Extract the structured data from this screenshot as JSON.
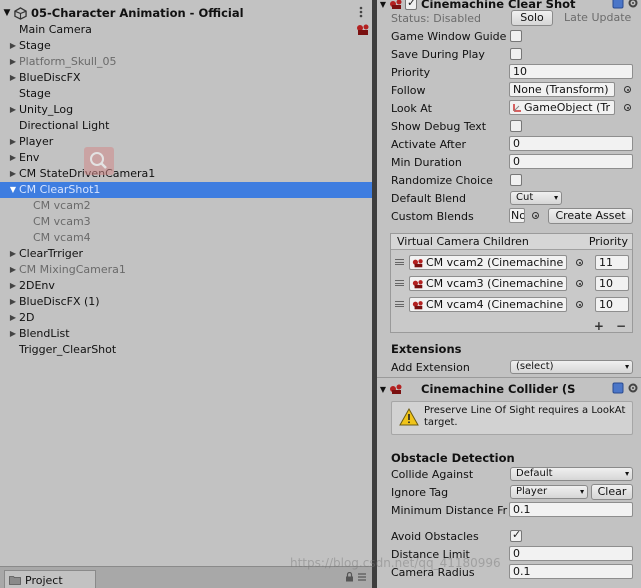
{
  "hierarchy": {
    "scene_title": "05-Character Animation - Official",
    "items": [
      {
        "label": "Main Camera",
        "indent": 0,
        "expand": false,
        "dim": false,
        "sel": false,
        "icon": "camera-gizmo"
      },
      {
        "label": "Stage",
        "indent": 0,
        "expand": true,
        "dim": false,
        "sel": false
      },
      {
        "label": "Platform_Skull_05",
        "indent": 0,
        "expand": true,
        "dim": true,
        "sel": false
      },
      {
        "label": "BlueDiscFX",
        "indent": 0,
        "expand": true,
        "dim": false,
        "sel": false
      },
      {
        "label": "Stage",
        "indent": 0,
        "expand": false,
        "dim": false,
        "sel": false
      },
      {
        "label": "Unity_Log",
        "indent": 0,
        "expand": true,
        "dim": false,
        "sel": false
      },
      {
        "label": "Directional Light",
        "indent": 0,
        "expand": false,
        "dim": false,
        "sel": false
      },
      {
        "label": "Player",
        "indent": 0,
        "expand": true,
        "dim": false,
        "sel": false
      },
      {
        "label": "Env",
        "indent": 0,
        "expand": true,
        "dim": false,
        "sel": false
      },
      {
        "label": "CM StateDrivenCamera1",
        "indent": 0,
        "expand": true,
        "dim": false,
        "sel": false
      },
      {
        "label": "CM ClearShot1",
        "indent": 0,
        "expand": true,
        "open": true,
        "dim": false,
        "sel": true
      },
      {
        "label": "CM vcam2",
        "indent": 1,
        "expand": false,
        "dim": true,
        "sel": false
      },
      {
        "label": "CM vcam3",
        "indent": 1,
        "expand": false,
        "dim": true,
        "sel": false
      },
      {
        "label": "CM vcam4",
        "indent": 1,
        "expand": false,
        "dim": true,
        "sel": false
      },
      {
        "label": "ClearTrriger",
        "indent": 0,
        "expand": true,
        "dim": false,
        "sel": false
      },
      {
        "label": "CM MixingCamera1",
        "indent": 0,
        "expand": true,
        "dim": true,
        "sel": false
      },
      {
        "label": "2DEnv",
        "indent": 0,
        "expand": true,
        "dim": false,
        "sel": false
      },
      {
        "label": "BlueDiscFX (1)",
        "indent": 0,
        "expand": true,
        "dim": false,
        "sel": false
      },
      {
        "label": "2D",
        "indent": 0,
        "expand": true,
        "dim": false,
        "sel": false
      },
      {
        "label": "BlendList",
        "indent": 0,
        "expand": true,
        "dim": false,
        "sel": false
      },
      {
        "label": "Trigger_ClearShot",
        "indent": 0,
        "expand": false,
        "dim": false,
        "sel": false
      }
    ]
  },
  "bottom_tab": {
    "label": "Project"
  },
  "clearshot": {
    "title": "Cinemachine Clear Shot",
    "status_label": "Status: Disabled",
    "solo_label": "Solo",
    "late_update": "Late Update",
    "fields": {
      "game_window_guides": "Game Window Guide",
      "save_during_play": "Save During Play",
      "priority": "Priority",
      "priority_value": "10",
      "follow": "Follow",
      "follow_value": "None (Transform)",
      "look_at": "Look At",
      "look_at_value": "GameObject (Tr",
      "show_debug_text": "Show Debug Text",
      "activate_after": "Activate After",
      "activate_after_value": "0",
      "min_duration": "Min Duration",
      "min_duration_value": "0",
      "randomize_choice": "Randomize Choice",
      "default_blend": "Default Blend",
      "default_blend_value": "Cut",
      "custom_blends": "Custom Blends",
      "custom_blends_value": "No",
      "create_asset": "Create Asset"
    },
    "children_list": {
      "col_name": "Virtual Camera Children",
      "col_priority": "Priority",
      "rows": [
        {
          "name": "CM vcam2 (Cinemachine",
          "priority": "11"
        },
        {
          "name": "CM vcam3 (Cinemachine",
          "priority": "10"
        },
        {
          "name": "CM vcam4 (Cinemachine",
          "priority": "10"
        }
      ],
      "add": "+",
      "remove": "−"
    },
    "extensions_title": "Extensions",
    "add_extension_label": "Add Extension",
    "add_extension_value": "(select)"
  },
  "collider": {
    "title": "Cinemachine Collider (S",
    "warning": "Preserve Line Of Sight requires a LookAt target.",
    "obstacle_title": "Obstacle Detection",
    "collide_against": "Collide Against",
    "collide_against_value": "Default",
    "ignore_tag": "Ignore Tag",
    "ignore_tag_value": "Player",
    "clear_label": "Clear",
    "min_distance": "Minimum Distance Fr",
    "min_distance_value": "0.1",
    "avoid_obstacles": "Avoid Obstacles",
    "distance_limit": "Distance Limit",
    "distance_limit_value": "0",
    "camera_radius": "Camera Radius",
    "camera_radius_value": "0.1"
  },
  "watermark": "https://blog.csdn.net/qq_41180996",
  "colors": {
    "selection": "#3e7de0",
    "panel": "#c2c2c2",
    "divider": "#3d3d3d"
  }
}
